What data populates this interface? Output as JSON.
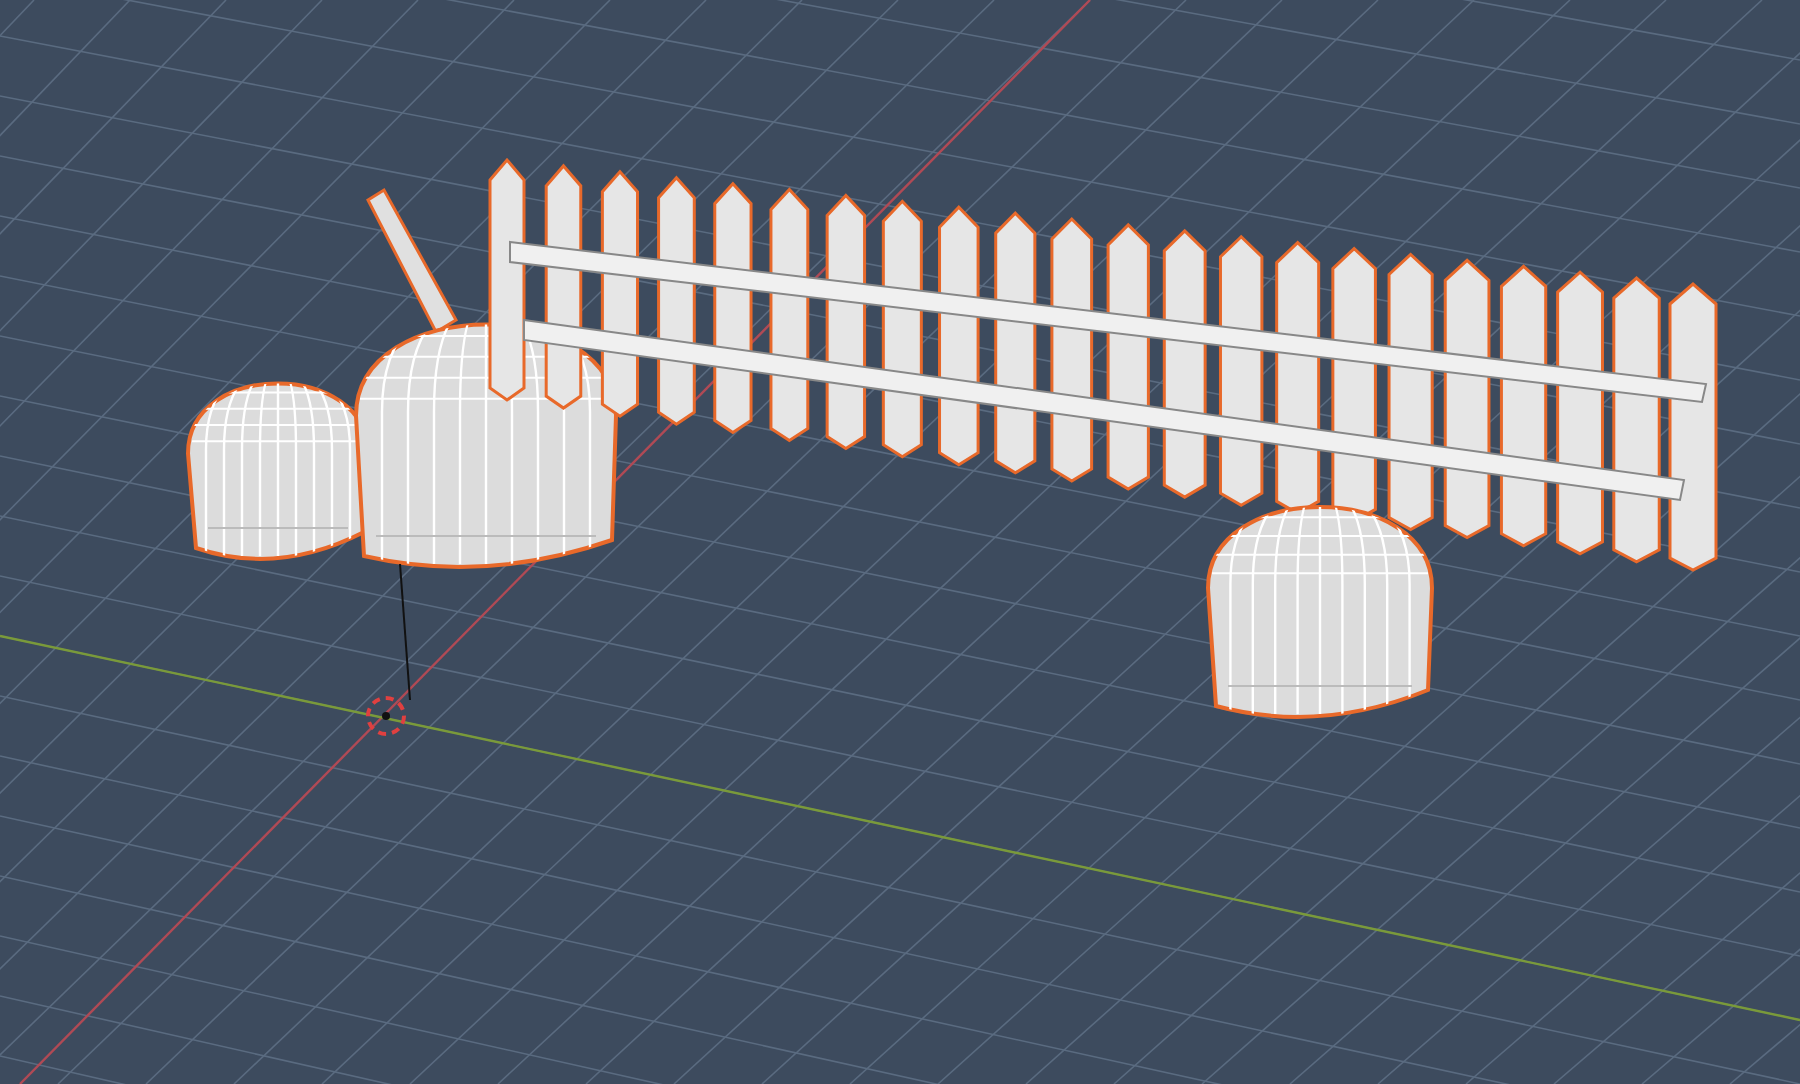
{
  "viewport": {
    "objects": [
      {
        "kind": "post",
        "selected": true
      },
      {
        "kind": "dome",
        "selected": true
      },
      {
        "kind": "dome",
        "selected": true
      },
      {
        "kind": "fence",
        "selected": true
      },
      {
        "kind": "dome",
        "selected": true
      },
      {
        "kind": "cursor",
        "selected": false
      }
    ]
  }
}
